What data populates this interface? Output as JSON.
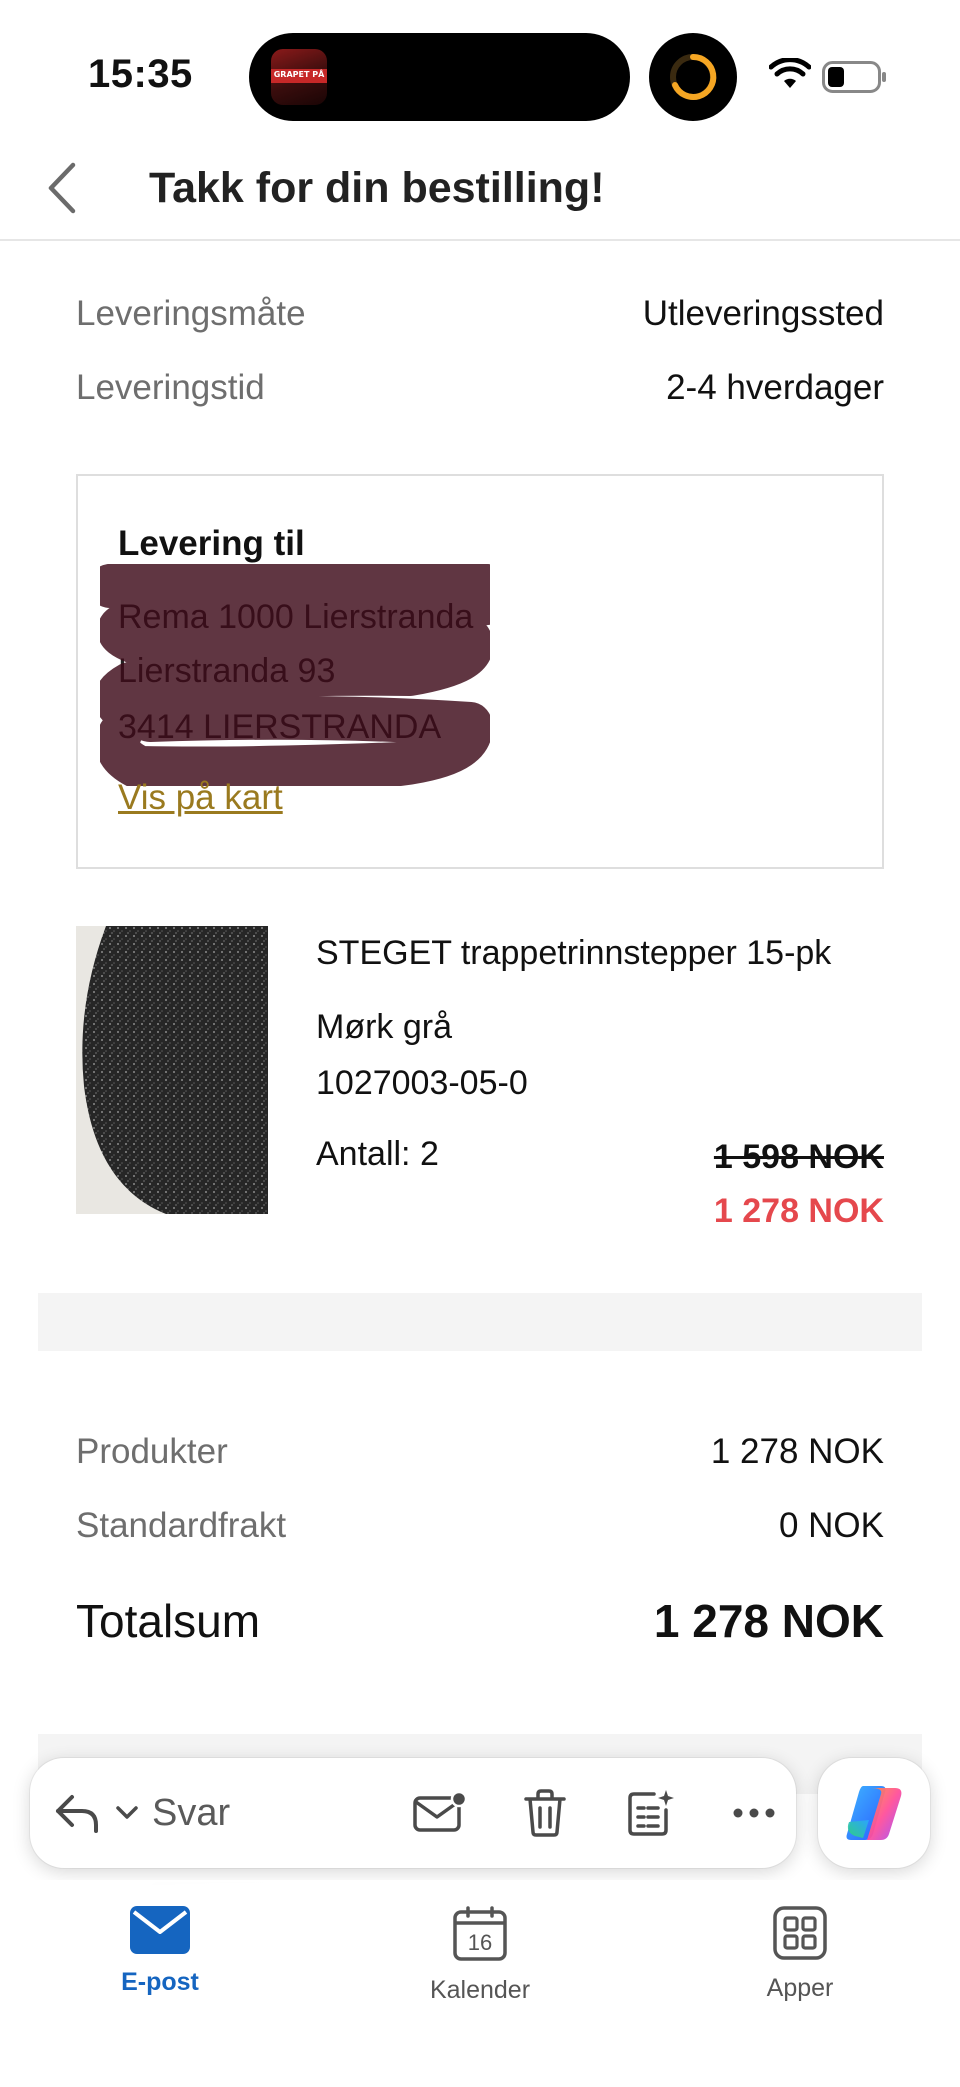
{
  "status_bar": {
    "time": "15:35",
    "live_activity_app_text": "GRAPET PÅ"
  },
  "header": {
    "title": "Takk for din bestilling!"
  },
  "delivery_info": {
    "method_label": "Leveringsmåte",
    "method_value": "Utleveringssted",
    "time_label": "Leveringstid",
    "time_value": "2-4 hverdager"
  },
  "delivery_box": {
    "title": "Levering til",
    "address_lines": [
      "Rema 1000 Lierstranda",
      "Lierstranda 93",
      "3414 LIERSTRANDA"
    ],
    "map_link": "Vis på kart"
  },
  "product": {
    "name": "STEGET trappetrinnstepper 15-pk",
    "color": "Mørk grå",
    "sku": "1027003-05-0",
    "quantity": "Antall: 2",
    "original_price": "1 598 NOK",
    "sale_price": "1 278 NOK",
    "colors": {
      "sale": "#e5484d"
    }
  },
  "summary": {
    "products_label": "Produkter",
    "products_value": "1 278 NOK",
    "shipping_label": "Standardfrakt",
    "shipping_value": "0 NOK",
    "total_label": "Totalsum",
    "total_value": "1 278 NOK"
  },
  "action_bar": {
    "reply_label": "Svar",
    "icons": [
      "reply-icon",
      "chevron-down-icon",
      "mark-unread-icon",
      "trash-icon",
      "summary-icon",
      "more-icon",
      "copilot-icon"
    ]
  },
  "tab_bar": {
    "tabs": [
      {
        "label": "E-post",
        "icon": "mail-icon",
        "active": true
      },
      {
        "label": "Kalender",
        "icon": "calendar-icon",
        "calendar_day": "16",
        "active": false
      },
      {
        "label": "Apper",
        "icon": "apps-icon",
        "active": false
      }
    ],
    "accent_color": "#1565c0"
  }
}
